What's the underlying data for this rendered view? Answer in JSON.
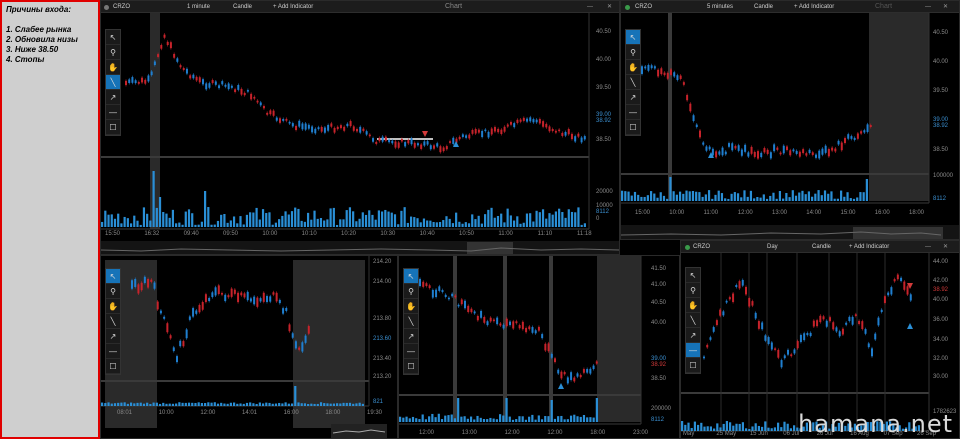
{
  "note": {
    "title": "Причины входа:",
    "items": [
      "1. Слабее рынка",
      "2. Обновила низы",
      "3. Ниже 38.50",
      "4. Стопы"
    ]
  },
  "toolbar_icons": [
    "cursor-icon",
    "zoom-icon",
    "pan-hand-icon",
    "line-tool-icon",
    "arrow-tool-icon",
    "hline-tool-icon",
    "rect-tool-icon"
  ],
  "colors": {
    "up": "#1f7fd0",
    "down": "#c8232b",
    "volume": "#2a8fd6",
    "selected": "#1673b8",
    "note_border": "#e00000"
  },
  "charts": [
    {
      "id": "main",
      "ticker": "CRZO",
      "interval": "1 minute",
      "type": "Candle",
      "add": "+ Add Indicator",
      "title": "Chart",
      "price_ticks": [
        "40.50",
        "40.00",
        "39.50",
        "38.50"
      ],
      "price_marks": [
        {
          "t": "39.00",
          "c": "p"
        },
        {
          "t": "38.92",
          "c": "p"
        }
      ],
      "vol_ticks": [
        "20000",
        "10000",
        "0"
      ],
      "vol_last": "8112",
      "time_ticks": [
        "15:50",
        "16:32",
        "09:40",
        "09:50",
        "10:00",
        "10:10",
        "10:20",
        "10:30",
        "10:40",
        "10:50",
        "11:00",
        "11:10",
        "11:18"
      ]
    },
    {
      "id": "m5",
      "ticker": "CRZO",
      "interval": "5 minutes",
      "type": "Candle",
      "add": "+ Add Indicator",
      "title": "Chart",
      "price_ticks": [
        "40.50",
        "40.00",
        "39.50",
        "38.50"
      ],
      "price_marks": [
        {
          "t": "39.00",
          "c": "p"
        },
        {
          "t": "38.92",
          "c": "p"
        }
      ],
      "vol_ticks": [
        "100000"
      ],
      "vol_last": "8112",
      "time_ticks": [
        "15:00",
        "10:00",
        "11:00",
        "12:00",
        "13:00",
        "14:00",
        "15:00",
        "16:00",
        "18:00"
      ]
    },
    {
      "id": "spy",
      "price_ticks": [
        "214.20",
        "214.00",
        "213.80",
        "213.40",
        "213.20"
      ],
      "price_marks": [
        {
          "t": "213.60",
          "c": "p"
        }
      ],
      "vol_last": "821",
      "time_ticks": [
        "08:01",
        "10:00",
        "12:00",
        "14:01",
        "16:00",
        "18:00",
        "19:30"
      ]
    },
    {
      "id": "m15",
      "price_ticks": [
        "41.50",
        "41.00",
        "40.50",
        "40.00",
        "38.50"
      ],
      "price_marks": [
        {
          "t": "39.00",
          "c": "p"
        },
        {
          "t": "38.92",
          "c": "r"
        }
      ],
      "vol_ticks": [
        "200000"
      ],
      "vol_last": "8112",
      "time_ticks": [
        "12:00",
        "13:00",
        "12:00",
        "12:00",
        "18:00",
        "23:00"
      ]
    },
    {
      "id": "daily",
      "ticker": "CRZO",
      "interval": "Day",
      "type": "Candle",
      "add": "+ Add Indicator",
      "price_ticks": [
        "44.00",
        "42.00",
        "40.00",
        "36.00",
        "34.00",
        "32.00",
        "30.00"
      ],
      "price_marks": [
        {
          "t": "38.92",
          "c": "r"
        }
      ],
      "vol_ticks": [
        "1782623"
      ],
      "time_ticks": [
        "May",
        "25 May",
        "15 Jun",
        "06 Jul",
        "26 Jul",
        "16 Aug",
        "07 Sep",
        "26 Sep"
      ]
    }
  ],
  "watermark": "hamana.net"
}
